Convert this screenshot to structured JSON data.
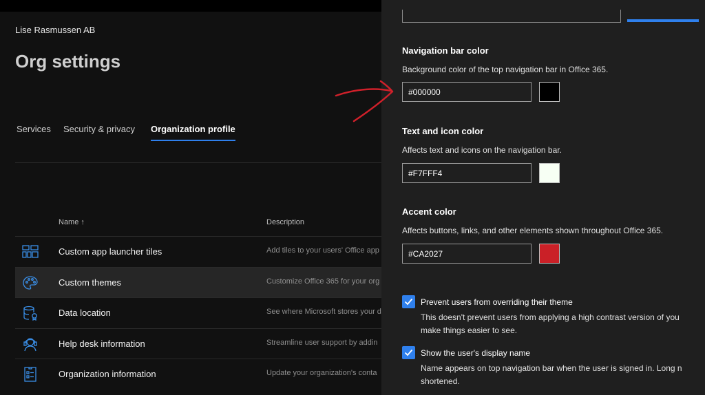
{
  "header": {
    "org_name": "Lise Rasmussen AB",
    "title": "Org settings"
  },
  "tabs": [
    {
      "label": "Services",
      "active": false
    },
    {
      "label": "Security & privacy",
      "active": false
    },
    {
      "label": "Organization profile",
      "active": true
    }
  ],
  "table": {
    "columns": {
      "name": "Name ↑",
      "description": "Description"
    },
    "rows": [
      {
        "name": "Custom app launcher tiles",
        "description": "Add tiles to your users' Office app",
        "icon": "app-tiles-icon"
      },
      {
        "name": "Custom themes",
        "description": "Customize Office 365 for your org",
        "icon": "palette-icon",
        "selected": true
      },
      {
        "name": "Data location",
        "description": "See where Microsoft stores your d",
        "icon": "database-icon"
      },
      {
        "name": "Help desk information",
        "description": "Streamline user support by addin",
        "icon": "headset-icon"
      },
      {
        "name": "Organization information",
        "description": "Update your organization's conta",
        "icon": "id-card-icon"
      }
    ]
  },
  "panel": {
    "nav_bar": {
      "title": "Navigation bar color",
      "description": "Background color of the top navigation bar in Office 365.",
      "value": "#000000",
      "swatch_color": "#000000"
    },
    "text_icon": {
      "title": "Text and icon color",
      "description": "Affects text and icons on the navigation bar.",
      "value": "#F7FFF4",
      "swatch_color": "#F7FFF4"
    },
    "accent": {
      "title": "Accent color",
      "description": "Affects buttons, links, and other elements shown throughout Office 365.",
      "value": "#CA2027",
      "swatch_color": "#CA2027"
    },
    "prevent_override": {
      "label": "Prevent users from overriding their theme",
      "description_line1": "This doesn't prevent users from applying a high contrast version of you",
      "description_line2": "make things easier to see.",
      "checked": true
    },
    "show_display_name": {
      "label": "Show the user's display name",
      "description_line1": "Name appears on top navigation bar when the user is signed in. Long n",
      "description_line2": "shortened.",
      "checked": true
    }
  },
  "colors": {
    "accent_blue": "#2f80ed",
    "annotation_red": "#d0202a"
  }
}
